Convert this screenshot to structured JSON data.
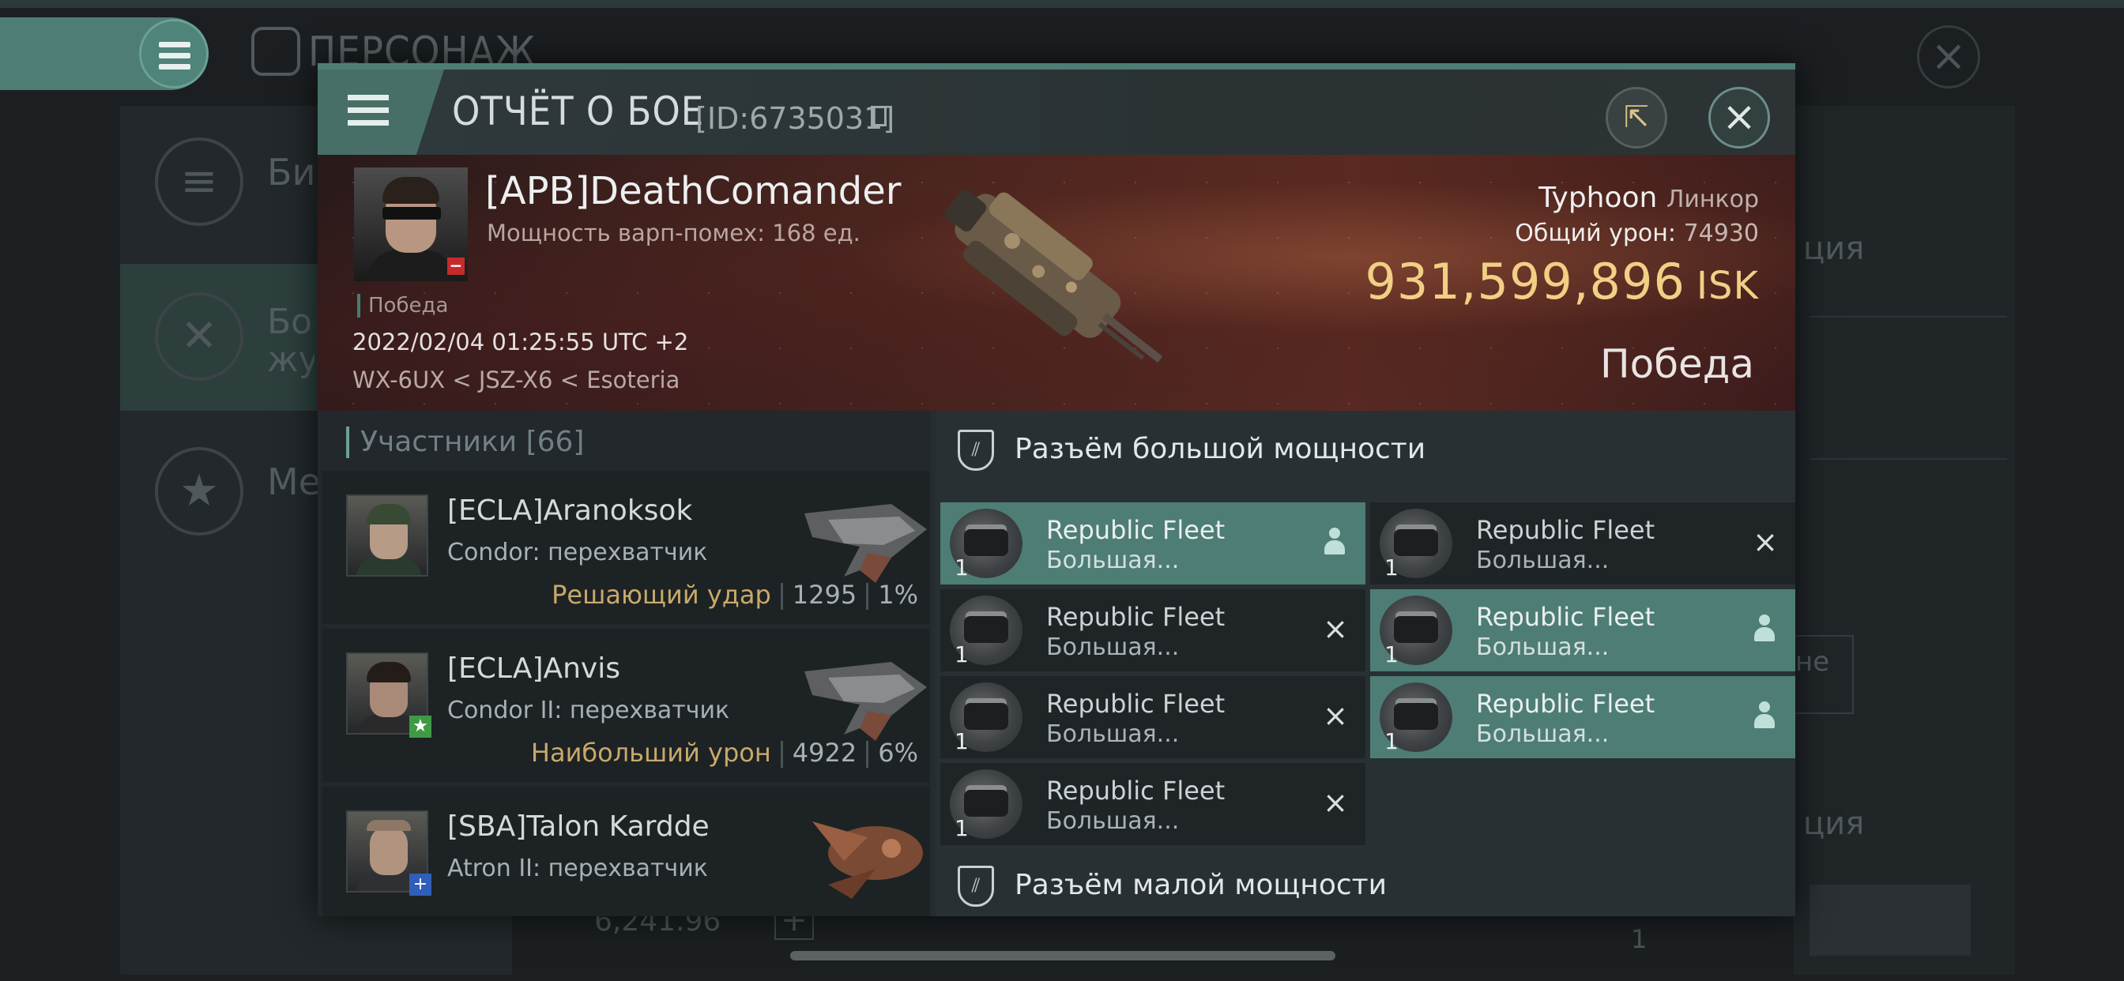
{
  "background_app": {
    "title": "ПЕРСОНАЖ",
    "sidebar": [
      {
        "label": "Био",
        "icon": "menu-lines-icon"
      },
      {
        "label": "Боевой журнал",
        "icon": "crossed-swords-icon",
        "active": true
      },
      {
        "label": "Мед",
        "icon": "star-badge-icon"
      }
    ],
    "right_fragments": [
      "ция",
      "не",
      "ция"
    ],
    "bottom_value": "6,241.96",
    "bottom_qty": "1"
  },
  "modal": {
    "title": "ОТЧЁТ О БОЕ",
    "report_id": "[ID:6735031]",
    "victim": {
      "name": "[APB]DeathComander",
      "warp": "Мощность варп-помех: 168 ед.",
      "result_small": "Победа",
      "timestamp": "2022/02/04 01:25:55 UTC +2",
      "location": "WX-6UX < JSZ-X6 < Esoteria",
      "ship": "Typhoon",
      "ship_class": "Линкор",
      "damage_label": "Общий урон:",
      "damage_value": "74930",
      "isk_value": "931,599,896",
      "isk_unit": "ISK",
      "result": "Победа"
    },
    "participants": {
      "label": "Участники",
      "count": "[66]",
      "items": [
        {
          "name": "[ECLA]Aranoksok",
          "ship": "Condor: перехватчик",
          "tag": "Решающий удар",
          "damage": "1295",
          "percent": "1%",
          "badge": ""
        },
        {
          "name": "[ECLA]Anvis",
          "ship": "Condor II: перехватчик",
          "tag": "Наибольший урон",
          "damage": "4922",
          "percent": "6%",
          "badge": "star"
        },
        {
          "name": "[SBA]Talon Kardde",
          "ship": "Atron II: перехватчик",
          "tag": "",
          "damage": "",
          "percent": "",
          "badge": "plus"
        }
      ]
    },
    "high_slots": {
      "label": "Разъём большой мощности",
      "items": [
        {
          "name1": "Republic Fleet",
          "name2": "Большая...",
          "qty": "1",
          "status": "dropped"
        },
        {
          "name1": "Republic Fleet",
          "name2": "Большая...",
          "qty": "1",
          "status": "destroyed"
        },
        {
          "name1": "Republic Fleet",
          "name2": "Большая...",
          "qty": "1",
          "status": "destroyed"
        },
        {
          "name1": "Republic Fleet",
          "name2": "Большая...",
          "qty": "1",
          "status": "dropped"
        },
        {
          "name1": "Republic Fleet",
          "name2": "Большая...",
          "qty": "1",
          "status": "destroyed"
        },
        {
          "name1": "Republic Fleet",
          "name2": "Большая...",
          "qty": "1",
          "status": "dropped"
        },
        {
          "name1": "Republic Fleet",
          "name2": "Большая...",
          "qty": "1",
          "status": "destroyed"
        }
      ]
    },
    "low_slots": {
      "label": "Разъём малой мощности"
    }
  },
  "colors": {
    "accent": "#4e7d75",
    "isk": "#f2cf85",
    "tag": "#c8a96a",
    "banner": "#4a2520"
  }
}
